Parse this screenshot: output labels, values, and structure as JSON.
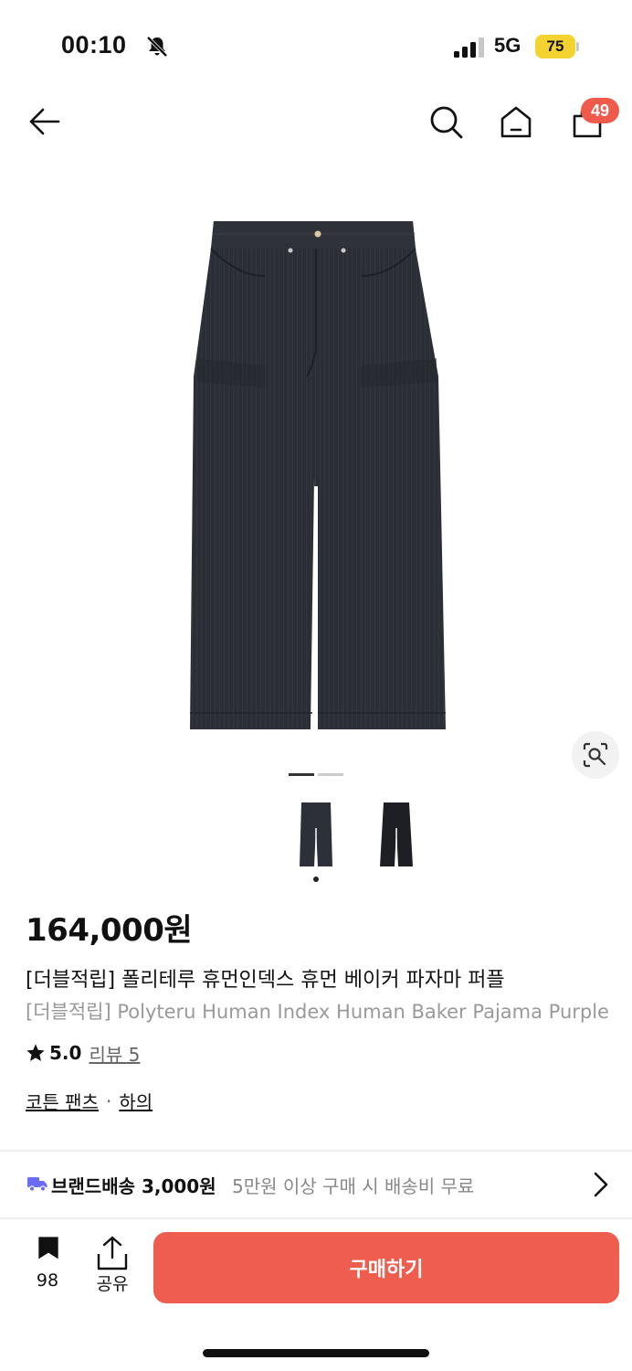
{
  "status_bar": {
    "time": "00:10",
    "network": "5G",
    "battery": "75"
  },
  "nav": {
    "cart_count": "49"
  },
  "product": {
    "price": "164,000원",
    "title_ko": "[더블적립] 폴리테루 휴먼인덱스 휴먼 베이커 파자마 퍼플",
    "title_en": "[더블적립] Polyteru Human Index Human Baker Pajama Purple",
    "rating": "5.0",
    "review_label": "리뷰 5",
    "categories": [
      "코튼 팬츠",
      "하의"
    ],
    "category_separator": "·"
  },
  "shipping": {
    "title": "브랜드배송 3,000원",
    "description": "5만원 이상 구매 시 배송비 무료"
  },
  "bottom_bar": {
    "bookmark_count": "98",
    "share_label": "공유",
    "buy_label": "구매하기"
  },
  "colors": {
    "accent": "#ef5d4e",
    "badge": "#ef5a4b",
    "truck": "#6b6cf6",
    "battery": "#f4d22f"
  },
  "icons": [
    "bell-off-icon",
    "signal-icon",
    "battery-icon",
    "back-arrow-icon",
    "search-icon",
    "home-icon",
    "cart-icon",
    "lens-search-icon",
    "star-icon",
    "truck-icon",
    "chevron-right-icon",
    "bookmark-icon",
    "share-icon"
  ]
}
